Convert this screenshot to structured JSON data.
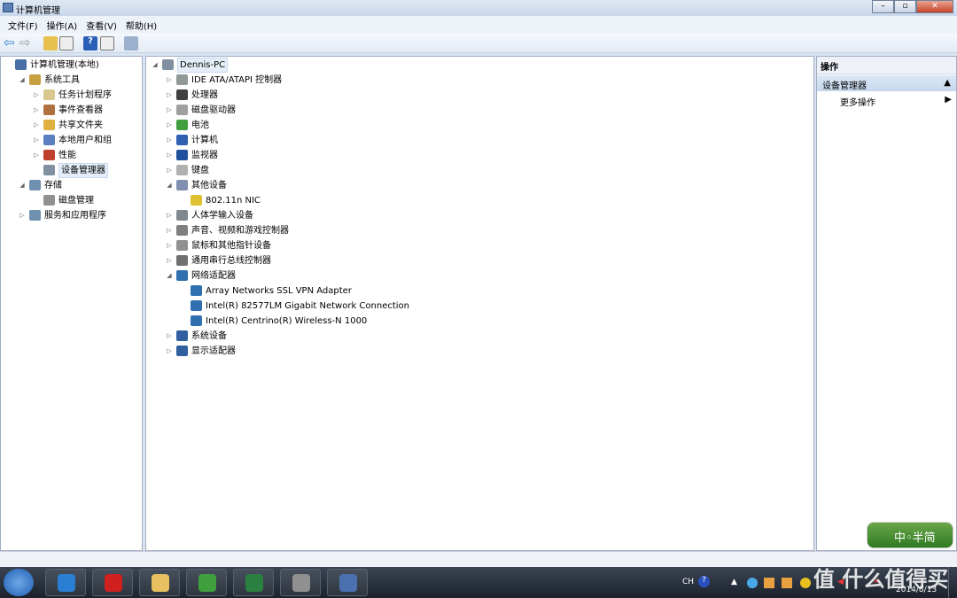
{
  "window": {
    "title": "计算机管理"
  },
  "menu": [
    "文件(F)",
    "操作(A)",
    "查看(V)",
    "帮助(H)"
  ],
  "left_tree": [
    {
      "label": "计算机管理(本地)",
      "level": 0,
      "exp": "",
      "icon": "computer-management-icon",
      "color": "#4a6fa5"
    },
    {
      "label": "系统工具",
      "level": 1,
      "exp": "◢",
      "icon": "tools-icon",
      "color": "#c8a040"
    },
    {
      "label": "任务计划程序",
      "level": 2,
      "exp": "▷",
      "icon": "clock-icon",
      "color": "#d8c890"
    },
    {
      "label": "事件查看器",
      "level": 2,
      "exp": "▷",
      "icon": "event-viewer-icon",
      "color": "#b07040"
    },
    {
      "label": "共享文件夹",
      "level": 2,
      "exp": "▷",
      "icon": "shared-folder-icon",
      "color": "#e0b040"
    },
    {
      "label": "本地用户和组",
      "level": 2,
      "exp": "▷",
      "icon": "users-icon",
      "color": "#5a80c0"
    },
    {
      "label": "性能",
      "level": 2,
      "exp": "▷",
      "icon": "performance-icon",
      "color": "#c04030"
    },
    {
      "label": "设备管理器",
      "level": 2,
      "exp": "",
      "icon": "device-manager-icon",
      "color": "#8090a0",
      "selected": true
    },
    {
      "label": "存储",
      "level": 1,
      "exp": "◢",
      "icon": "storage-icon",
      "color": "#7090b0"
    },
    {
      "label": "磁盘管理",
      "level": 2,
      "exp": "",
      "icon": "disk-management-icon",
      "color": "#909090"
    },
    {
      "label": "服务和应用程序",
      "level": 1,
      "exp": "▷",
      "icon": "services-icon",
      "color": "#7090b0"
    }
  ],
  "device_tree": [
    {
      "label": "Dennis-PC",
      "level": 0,
      "exp": "◢",
      "icon": "computer-icon",
      "color": "#8090a0",
      "selected": true
    },
    {
      "label": "IDE ATA/ATAPI 控制器",
      "level": 1,
      "exp": "▷",
      "icon": "ide-controller-icon",
      "color": "#909898"
    },
    {
      "label": "处理器",
      "level": 1,
      "exp": "▷",
      "icon": "processor-icon",
      "color": "#404040"
    },
    {
      "label": "磁盘驱动器",
      "level": 1,
      "exp": "▷",
      "icon": "disk-drive-icon",
      "color": "#a0a0a0"
    },
    {
      "label": "电池",
      "level": 1,
      "exp": "▷",
      "icon": "battery-icon",
      "color": "#40a040"
    },
    {
      "label": "计算机",
      "level": 1,
      "exp": "▷",
      "icon": "computer-icon",
      "color": "#3060b0"
    },
    {
      "label": "监视器",
      "level": 1,
      "exp": "▷",
      "icon": "monitor-icon",
      "color": "#2050a0"
    },
    {
      "label": "键盘",
      "level": 1,
      "exp": "▷",
      "icon": "keyboard-icon",
      "color": "#b0b0b0"
    },
    {
      "label": "其他设备",
      "level": 1,
      "exp": "◢",
      "icon": "other-devices-icon",
      "color": "#8090b0"
    },
    {
      "label": "802.11n NIC",
      "level": 2,
      "exp": "",
      "icon": "warning-device-icon",
      "color": "#e0c030"
    },
    {
      "label": "人体学输入设备",
      "level": 1,
      "exp": "▷",
      "icon": "hid-icon",
      "color": "#808890"
    },
    {
      "label": "声音、视频和游戏控制器",
      "level": 1,
      "exp": "▷",
      "icon": "sound-icon",
      "color": "#808080"
    },
    {
      "label": "鼠标和其他指针设备",
      "level": 1,
      "exp": "▷",
      "icon": "mouse-icon",
      "color": "#909090"
    },
    {
      "label": "通用串行总线控制器",
      "level": 1,
      "exp": "▷",
      "icon": "usb-icon",
      "color": "#707070"
    },
    {
      "label": "网络适配器",
      "level": 1,
      "exp": "◢",
      "icon": "network-adapter-icon",
      "color": "#3070b0"
    },
    {
      "label": "Array Networks SSL VPN Adapter",
      "level": 2,
      "exp": "",
      "icon": "network-adapter-icon",
      "color": "#3070b0"
    },
    {
      "label": "Intel(R) 82577LM Gigabit Network Connection",
      "level": 2,
      "exp": "",
      "icon": "network-adapter-icon",
      "color": "#3070b0"
    },
    {
      "label": "Intel(R) Centrino(R) Wireless-N 1000",
      "level": 2,
      "exp": "",
      "icon": "network-adapter-icon",
      "color": "#3070b0"
    },
    {
      "label": "系统设备",
      "level": 1,
      "exp": "▷",
      "icon": "system-devices-icon",
      "color": "#3060a0"
    },
    {
      "label": "显示适配器",
      "level": 1,
      "exp": "▷",
      "icon": "display-adapter-icon",
      "color": "#3060a0"
    }
  ],
  "actions": {
    "header": "操作",
    "section": "设备管理器",
    "more": "更多操作"
  },
  "ime": {
    "label": "中◦半简"
  },
  "tray": {
    "lang": "CH",
    "date": "2014/8/13"
  },
  "watermark": "值 什么值得买",
  "taskbar_apps": [
    {
      "name": "internet-explorer",
      "color": "#2a7fd4"
    },
    {
      "name": "app-red",
      "color": "#d02020"
    },
    {
      "name": "file-explorer",
      "color": "#e8c060"
    },
    {
      "name": "chrome",
      "color": "#40a040"
    },
    {
      "name": "excel",
      "color": "#2a8040"
    },
    {
      "name": "app-photo",
      "color": "#909090"
    },
    {
      "name": "computer-management",
      "color": "#4a70b0"
    }
  ]
}
